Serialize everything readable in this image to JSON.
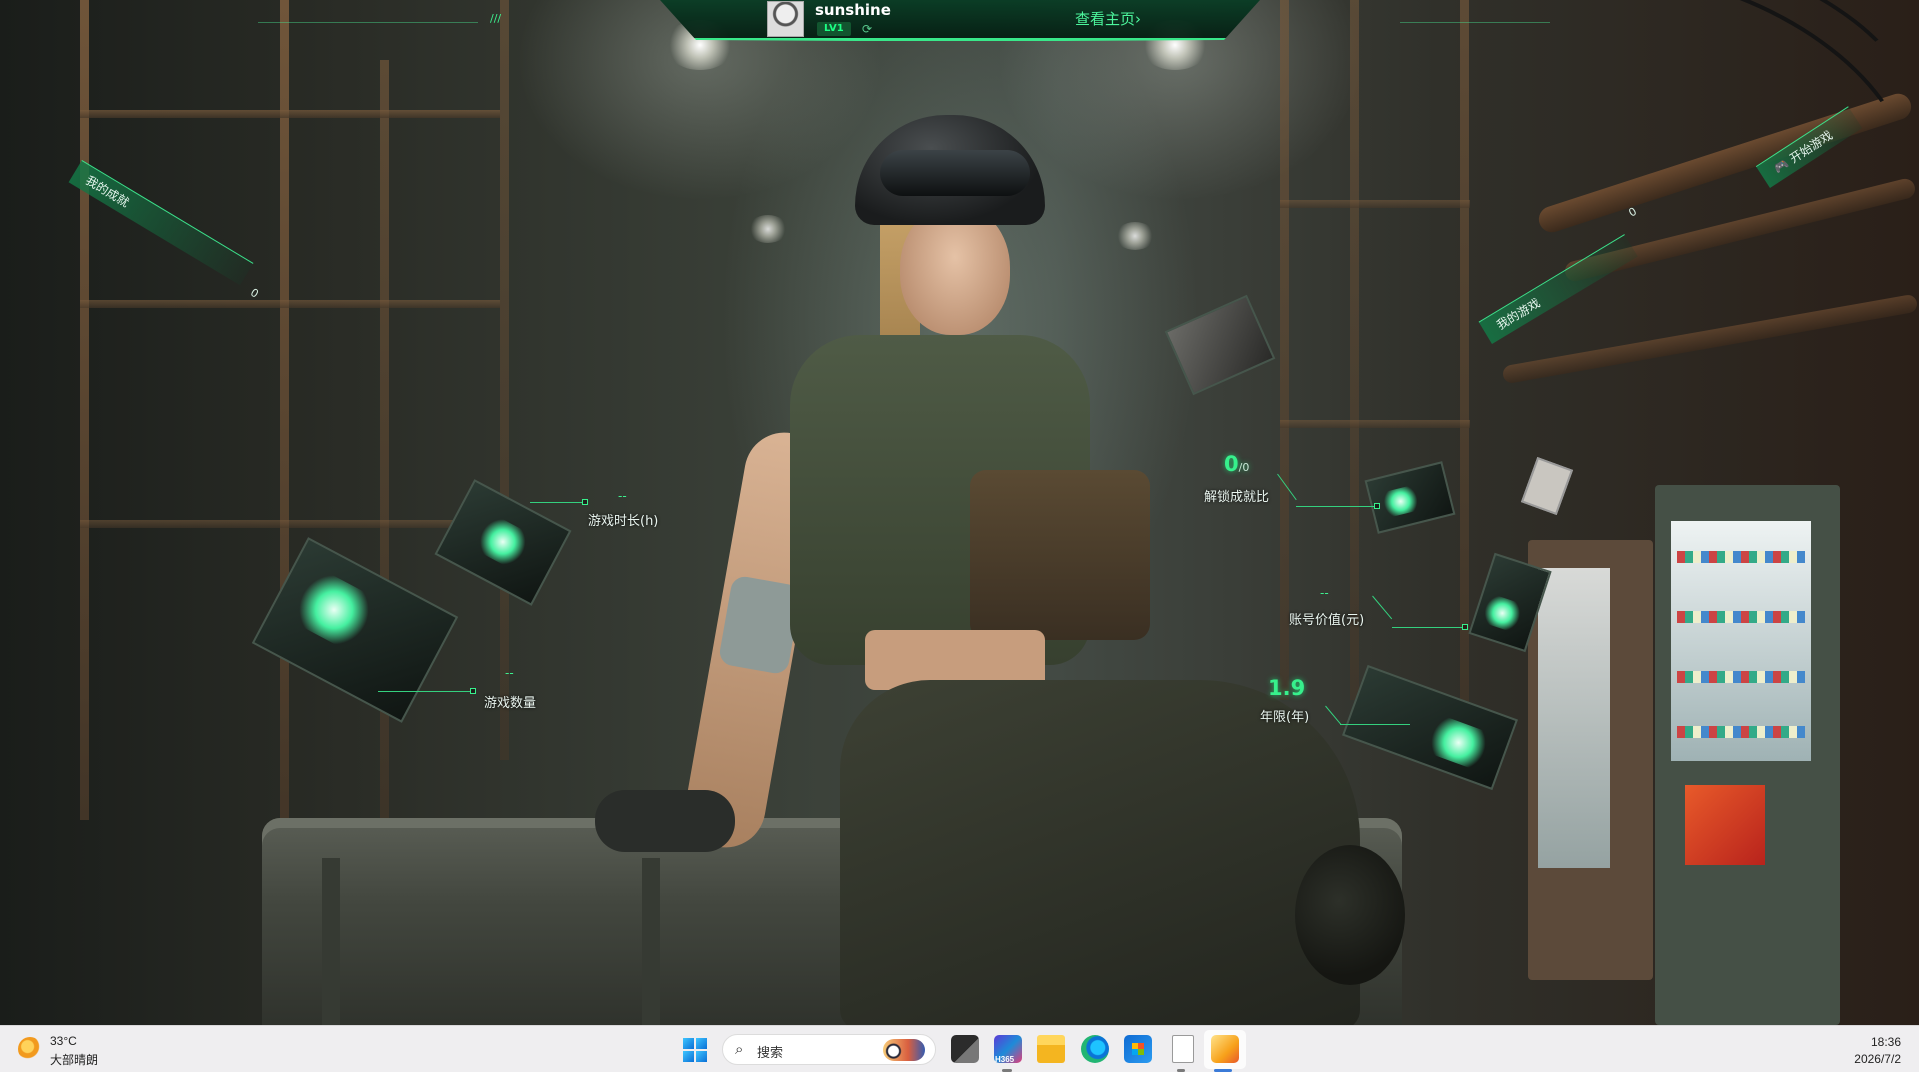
{
  "topbar": {
    "username": "sunshine",
    "level": "LV1",
    "home_link": "查看主页",
    "home_chevron": "›",
    "refresh_icon": "refresh-icon"
  },
  "banners": {
    "achievements": {
      "label": "我的成就",
      "count": "0"
    },
    "games": {
      "label": "我的游戏",
      "count": "0"
    },
    "start_game": {
      "label": "开始游戏"
    }
  },
  "stats": {
    "play_time": {
      "value": "--",
      "label": "游戏时长(h)"
    },
    "game_count": {
      "value": "--",
      "label": "游戏数量"
    },
    "unlock_ratio": {
      "value": "0",
      "total": "/0",
      "label": "解锁成就比"
    },
    "account_value": {
      "value": "--",
      "label": "账号价值(元)"
    },
    "account_age": {
      "value": "1.9",
      "label": "年限(年)"
    }
  },
  "taskbar": {
    "weather": {
      "temp": "33°C",
      "desc": "大部晴朗",
      "icon": "weather-sun-icon"
    },
    "search": {
      "placeholder": "搜索",
      "icon": "search-icon"
    },
    "apps": [
      "start-icon",
      "task-view-icon",
      "nyx-app-icon",
      "file-explorer-icon",
      "edge-icon",
      "store-icon",
      "notepad-icon",
      "wallpaper-app-icon"
    ],
    "nyx_badge": "H365",
    "clock": {
      "time": "18:36",
      "date": "2026/7/2"
    }
  },
  "colors": {
    "accent": "#39e88a",
    "hud_text": "#e9f5ef",
    "taskbar_bg": "#efeef0"
  }
}
